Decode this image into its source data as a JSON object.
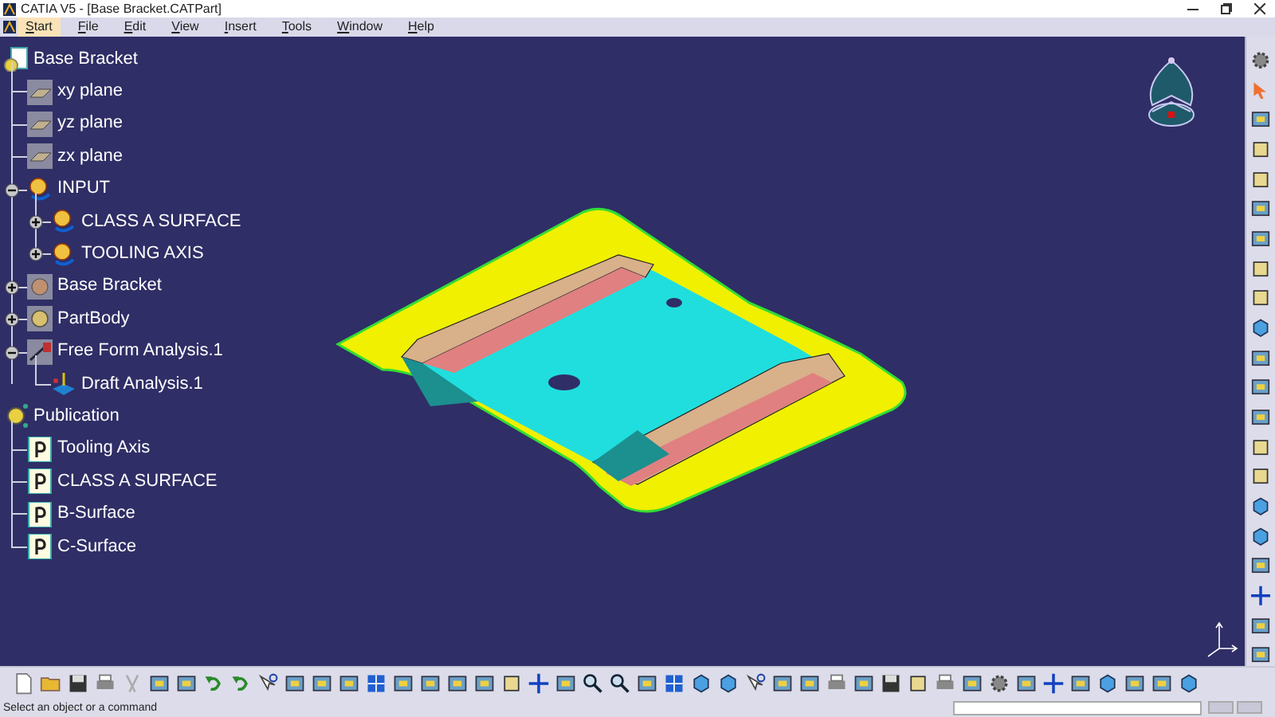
{
  "window": {
    "title": "CATIA V5 - [Base Bracket.CATPart]"
  },
  "menu": [
    {
      "label": "Start",
      "selected": true
    },
    {
      "label": "File",
      "selected": false
    },
    {
      "label": "Edit",
      "selected": false
    },
    {
      "label": "View",
      "selected": false
    },
    {
      "label": "Insert",
      "selected": false
    },
    {
      "label": "Tools",
      "selected": false
    },
    {
      "label": "Window",
      "selected": false
    },
    {
      "label": "Help",
      "selected": false
    }
  ],
  "tree": [
    {
      "label": "Base Bracket",
      "kind": "part",
      "children": [
        {
          "label": "xy plane",
          "kind": "plane"
        },
        {
          "label": "yz plane",
          "kind": "plane"
        },
        {
          "label": "zx plane",
          "kind": "plane"
        },
        {
          "label": "INPUT",
          "kind": "geoset",
          "expanded": true,
          "children": [
            {
              "label": "CLASS A SURFACE",
              "kind": "geoset",
              "expanded": false
            },
            {
              "label": "TOOLING AXIS",
              "kind": "geoset",
              "expanded": false
            }
          ]
        },
        {
          "label": "Base Bracket",
          "kind": "set",
          "expanded": false
        },
        {
          "label": "PartBody",
          "kind": "body",
          "expanded": false
        },
        {
          "label": "Free Form Analysis.1",
          "kind": "analysis",
          "expanded": true,
          "children": [
            {
              "label": "Draft Analysis.1",
              "kind": "draft"
            }
          ]
        }
      ]
    },
    {
      "label": "Publication",
      "kind": "publications",
      "children": [
        {
          "label": "Tooling Axis",
          "kind": "publication"
        },
        {
          "label": "CLASS A SURFACE",
          "kind": "publication"
        },
        {
          "label": "B-Surface",
          "kind": "publication"
        },
        {
          "label": "C-Surface",
          "kind": "publication"
        }
      ]
    }
  ],
  "status_bar": {
    "message": "Select an object or a command"
  }
}
